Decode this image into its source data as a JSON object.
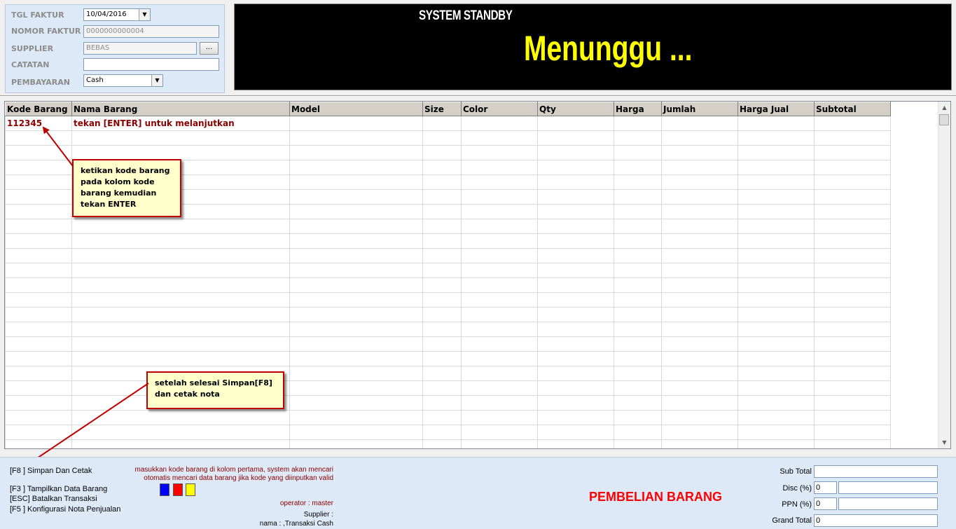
{
  "form": {
    "tgl_faktur": {
      "label": "TGL FAKTUR",
      "value": "10/04/2016"
    },
    "nomor_faktur": {
      "label": "NOMOR FAKTUR",
      "value": "0000000000004"
    },
    "supplier": {
      "label": "SUPPLIER",
      "value": "BEBAS",
      "button": "..."
    },
    "catatan": {
      "label": "CATATAN",
      "value": ""
    },
    "pembayaran": {
      "label": "PEMBAYARAN",
      "value": "Cash"
    }
  },
  "display": {
    "status": "SYSTEM STANDBY",
    "message": "Menunggu ..."
  },
  "grid": {
    "columns": [
      "Kode Barang",
      "Nama Barang",
      "Model",
      "Size",
      "Color",
      "Qty",
      "Harga",
      "Jumlah",
      "Harga Jual",
      "Subtotal"
    ],
    "row1": {
      "kode": "112345",
      "nama": "tekan [ENTER] untuk melanjutkan"
    }
  },
  "callouts": {
    "kode": "ketikan kode barang pada kolom kode barang kemudian tekan ENTER",
    "simpan": "setelah selesai Simpan[F8] dan cetak nota"
  },
  "shortcuts": {
    "f8": "[F8 ] Simpan Dan Cetak",
    "f3": "[F3 ] Tampilkan Data Barang",
    "esc": "[ESC] Batalkan Transaksi",
    "f5": "[F5 ] Konfigurasi Nota Penjualan"
  },
  "info": {
    "line1": "masukkan kode barang di kolom pertama, system akan mencari",
    "line2": "otomatis mencari data barang jika kode yang diinputkan valid",
    "operator": "operator : master",
    "supplier": "Supplier :",
    "nama": "nama : ,Transaksi Cash"
  },
  "legend_colors": [
    "#0000ff",
    "#ff0000",
    "#ffff00"
  ],
  "page_title": "PEMBELIAN BARANG",
  "totals": {
    "sub_total": {
      "label": "Sub Total",
      "value": ""
    },
    "disc": {
      "label": "Disc (%)",
      "value": "0",
      "amount": ""
    },
    "ppn": {
      "label": "PPN (%)",
      "value": "0",
      "amount": ""
    },
    "grand_total": {
      "label": "Grand Total",
      "value": "0"
    }
  }
}
